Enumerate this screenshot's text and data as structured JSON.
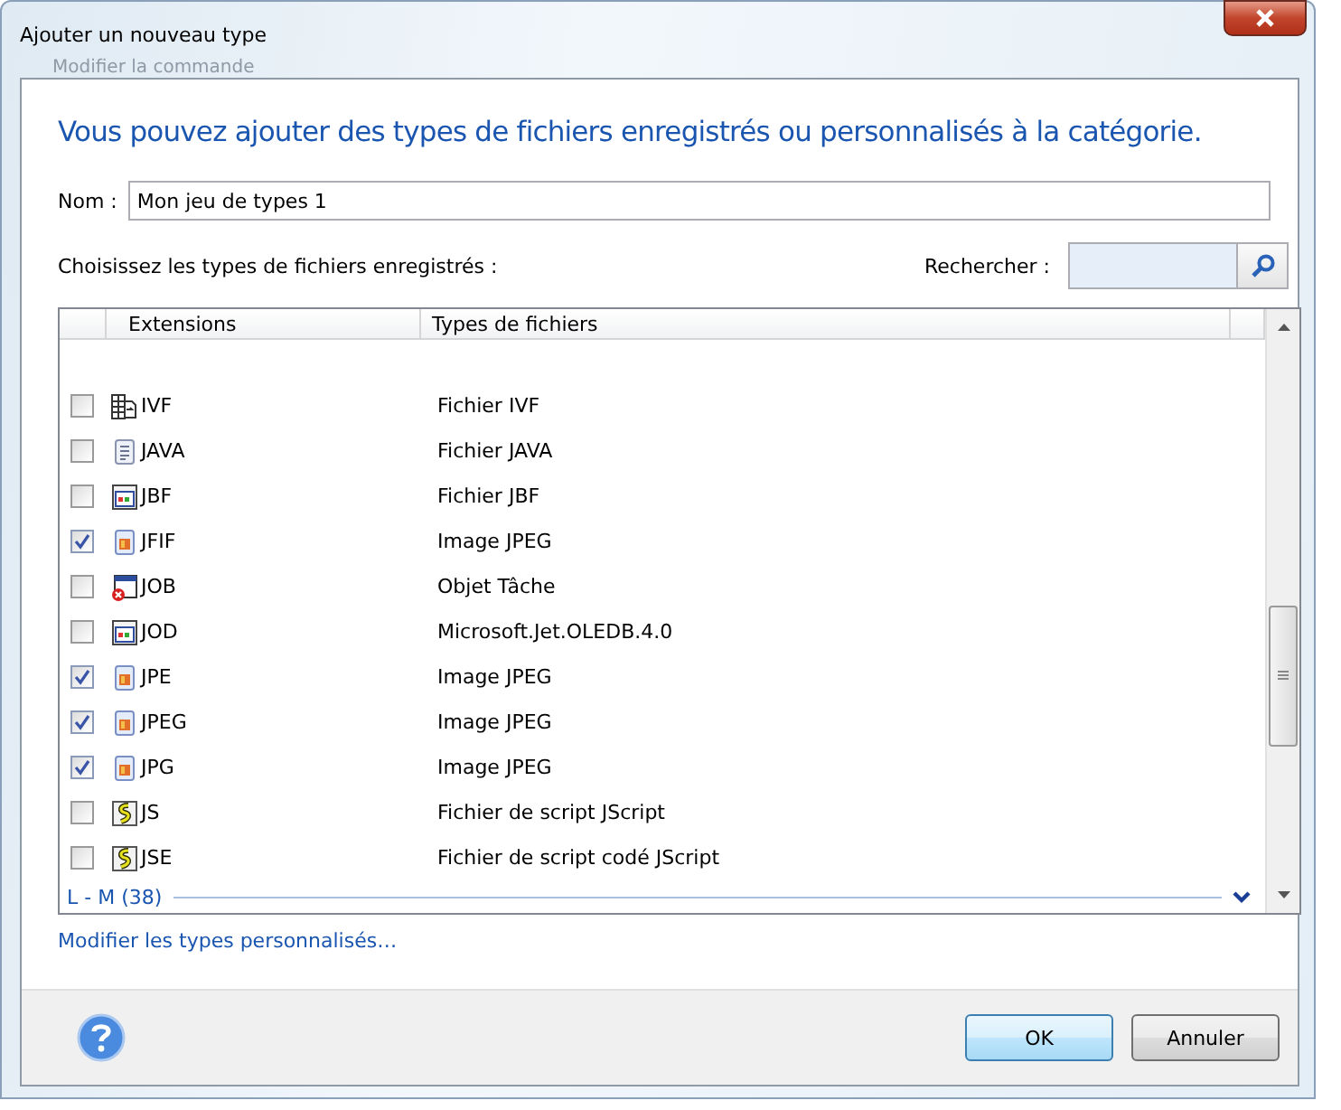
{
  "window": {
    "title": "Ajouter un nouveau type",
    "background_text": "Modifier la commande"
  },
  "heading": "Vous pouvez ajouter des types de fichiers enregistrés ou personnalisés à la catégorie.",
  "name_field": {
    "label": "Nom :",
    "value": "Mon jeu de types 1"
  },
  "choose_label": "Choisissez les types de fichiers enregistrés :",
  "search": {
    "label": "Rechercher :"
  },
  "table": {
    "columns": [
      "Extensions",
      "Types de fichiers"
    ],
    "rows": [
      {
        "kind": "video",
        "extension": "IVF",
        "type": "Fichier IVF",
        "checked": false
      },
      {
        "kind": "text",
        "extension": "JAVA",
        "type": "Fichier JAVA",
        "checked": false
      },
      {
        "kind": "window",
        "extension": "JBF",
        "type": "Fichier JBF",
        "checked": false
      },
      {
        "kind": "image",
        "extension": "JFIF",
        "type": "Image JPEG",
        "checked": true
      },
      {
        "kind": "task",
        "extension": "JOB",
        "type": "Objet Tâche",
        "checked": false
      },
      {
        "kind": "window",
        "extension": "JOD",
        "type": "Microsoft.Jet.OLEDB.4.0",
        "checked": false
      },
      {
        "kind": "image",
        "extension": "JPE",
        "type": "Image JPEG",
        "checked": true
      },
      {
        "kind": "image",
        "extension": "JPEG",
        "type": "Image JPEG",
        "checked": true
      },
      {
        "kind": "image",
        "extension": "JPG",
        "type": "Image JPEG",
        "checked": true
      },
      {
        "kind": "script",
        "extension": "JS",
        "type": "Fichier de script JScript",
        "checked": false
      },
      {
        "kind": "script",
        "extension": "JSE",
        "type": "Fichier de script codé JScript",
        "checked": false
      }
    ],
    "group": {
      "label": "L - M (38)",
      "expanded": false
    }
  },
  "link": "Modifier les types personnalisés…",
  "buttons": [
    {
      "label": "OK",
      "default": true
    },
    {
      "label": "Annuler",
      "default": false
    }
  ]
}
